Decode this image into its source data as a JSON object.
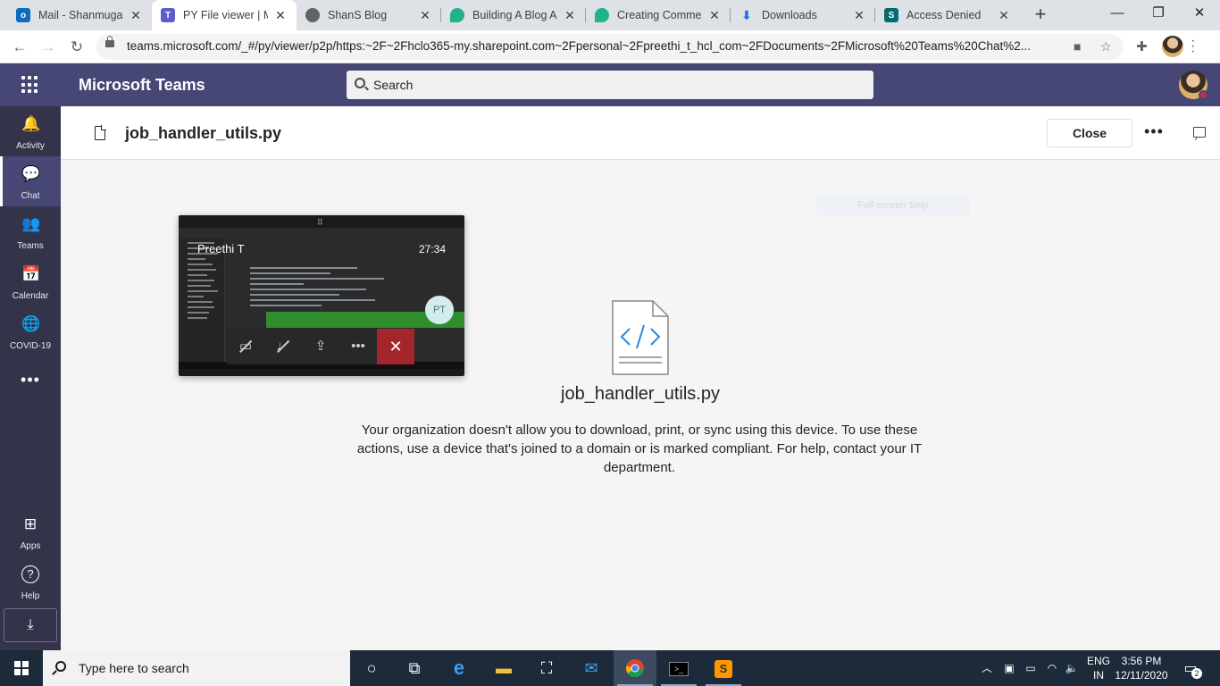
{
  "browser": {
    "tabs": [
      {
        "label": "Mail - Shanmugan",
        "favicon_color": "#0f6cbd",
        "favicon_text": "o"
      },
      {
        "label": "PY File viewer | Mi",
        "favicon_color": "#5b5fc7",
        "favicon_text": "T"
      },
      {
        "label": "ShanS Blog",
        "favicon_color": "#5f6368",
        "favicon_text": ""
      },
      {
        "label": "Building A Blog Ap",
        "favicon_color": "#20b28a",
        "favicon_text": ""
      },
      {
        "label": "Creating Commen",
        "favicon_color": "#20b28a",
        "favicon_text": ""
      },
      {
        "label": "Downloads",
        "favicon_color": "#1a73e8",
        "favicon_text": "⬇"
      },
      {
        "label": "Access Denied",
        "favicon_color": "#036c70",
        "favicon_text": "S"
      }
    ],
    "new_tab_icon": "+",
    "url": "teams.microsoft.com/_#/py/viewer/p2p/https:~2F~2Fhclo365-my.sharepoint.com~2Fpersonal~2Fpreethi_t_hcl_com~2FDocuments~2FMicrosoft%20Teams%20Chat%2..."
  },
  "teams": {
    "app_name": "Microsoft Teams",
    "search_placeholder": "Search",
    "rail": [
      {
        "label": "Activity",
        "icon": "🔔"
      },
      {
        "label": "Chat",
        "icon": "💬"
      },
      {
        "label": "Teams",
        "icon": "👥"
      },
      {
        "label": "Calendar",
        "icon": "📅"
      },
      {
        "label": "COVID-19",
        "icon": "🌐"
      },
      {
        "label": "Apps",
        "icon": "⊞"
      },
      {
        "label": "Help",
        "icon": "?"
      }
    ],
    "rail_more": "•••"
  },
  "viewer": {
    "file_name": "job_handler_utils.py",
    "close_label": "Close",
    "more_label": "•••",
    "preview_file_name": "job_handler_utils.py",
    "policy_message": "Your organization doesn't allow you to download, print, or sync using this device. To use these actions, use a device that's joined to a domain or is marked compliant. For help, contact your IT department.",
    "snip_label": "Full-screen Snip"
  },
  "call": {
    "caller_name": "Preethi T",
    "timer": "27:34",
    "avatar_initials": "PT"
  },
  "taskbar": {
    "search_placeholder": "Type here to search",
    "lang_line1": "ENG",
    "lang_line2": "IN",
    "time": "3:56 PM",
    "date": "12/11/2020",
    "notification_count": "2"
  }
}
